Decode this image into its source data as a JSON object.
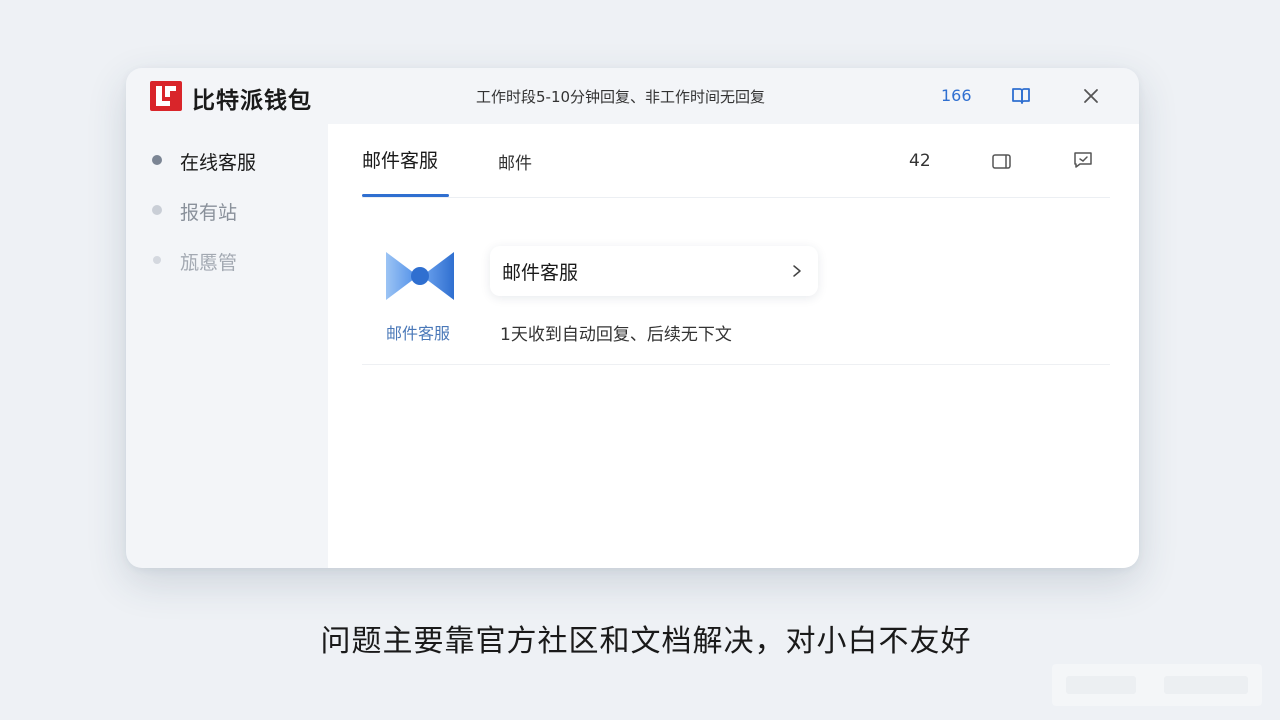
{
  "app": {
    "name": "比特派钱包",
    "notice": "工作时段5-10分钟回复、非工作时间无回复",
    "top_count": "166"
  },
  "sidebar": {
    "items": [
      {
        "label": "在线客服",
        "active": true
      },
      {
        "label": "报有站",
        "active": false
      },
      {
        "label": "瓬慝管",
        "active": false
      }
    ]
  },
  "tabs": {
    "active_label": "邮件客服",
    "second_label": "邮件",
    "count": "42"
  },
  "service": {
    "icon_caption": "邮件客服",
    "card_title": "邮件客服",
    "description": "1天收到自动回复、后续无下文"
  },
  "caption": "问题主要靠官方社区和文档解决，对小白不友好",
  "icons": {
    "logo": "bitpie-logo-icon",
    "book": "book-icon",
    "close": "close-icon",
    "tab_a": "device-icon",
    "tab_b": "chat-icon",
    "service": "mail-service-icon",
    "chevron": "chevron-right-icon"
  },
  "colors": {
    "accent": "#2f6fd0",
    "logo_red": "#d9252a",
    "active_dot": "#7b8594",
    "inactive_dot": "#c9ced6"
  }
}
